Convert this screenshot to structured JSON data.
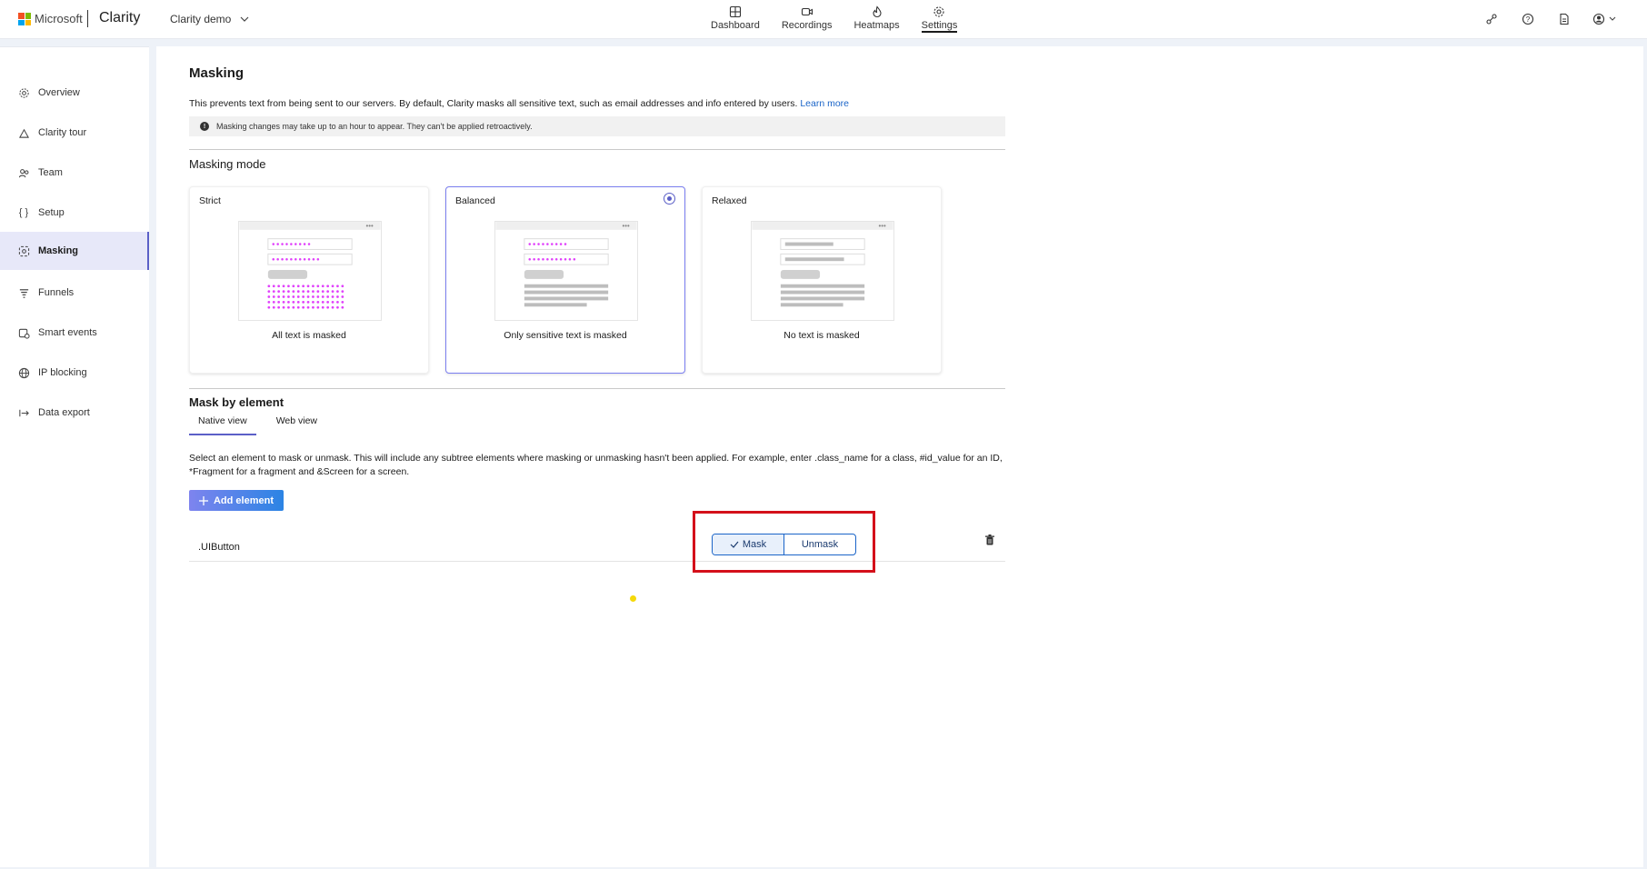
{
  "header": {
    "ms_name": "Microsoft",
    "brand": "Clarity",
    "project": "Clarity demo",
    "nav": [
      {
        "label": "Dashboard",
        "icon": "dashboard-icon"
      },
      {
        "label": "Recordings",
        "icon": "video-icon"
      },
      {
        "label": "Heatmaps",
        "icon": "flame-icon"
      },
      {
        "label": "Settings",
        "icon": "gear-icon",
        "active": true
      }
    ],
    "top_icons": [
      "share-icon",
      "help-icon",
      "document-icon",
      "account-icon"
    ]
  },
  "sidebar": {
    "items": [
      {
        "label": "Overview",
        "icon": "gear-icon"
      },
      {
        "label": "Clarity tour",
        "icon": "tour-icon"
      },
      {
        "label": "Team",
        "icon": "team-icon"
      },
      {
        "label": "Setup",
        "icon": "braces-icon"
      },
      {
        "label": "Masking",
        "icon": "masking-icon",
        "active": true
      },
      {
        "label": "Funnels",
        "icon": "funnel-icon"
      },
      {
        "label": "Smart events",
        "icon": "smart-events-icon"
      },
      {
        "label": "IP blocking",
        "icon": "globe-icon"
      },
      {
        "label": "Data export",
        "icon": "export-icon"
      }
    ]
  },
  "masking": {
    "title": "Masking",
    "description": "This prevents text from being sent to our servers. By default, Clarity masks all sensitive text, such as email addresses and info entered by users.",
    "learn_more": "Learn more",
    "notice": "Masking changes may take up to an hour to appear. They can't be applied retroactively."
  },
  "masking_mode": {
    "title": "Masking mode",
    "options": [
      {
        "title": "Strict",
        "caption": "All text is masked"
      },
      {
        "title": "Balanced",
        "caption": "Only sensitive text is masked",
        "selected": true
      },
      {
        "title": "Relaxed",
        "caption": "No text is masked"
      }
    ]
  },
  "mask_by_element": {
    "title": "Mask by element",
    "tabs": [
      "Native view",
      "Web view"
    ],
    "active_tab": "Native view",
    "description": "Select an element to mask or unmask. This will include any subtree elements where masking or unmasking hasn't been applied. For example, enter .class_name for a class, #id_value for an ID, *Fragment for a fragment and &Screen for a screen.",
    "add_button": "Add element",
    "rows": [
      {
        "element": ".UIButton",
        "mask_label": "Mask",
        "unmask_label": "Unmask",
        "selected": "Mask"
      }
    ]
  },
  "colors": {
    "accent": "#5b5fc7",
    "link": "#1a64c8",
    "mask_dots": "#e040fb",
    "highlight": "#d4101a"
  }
}
